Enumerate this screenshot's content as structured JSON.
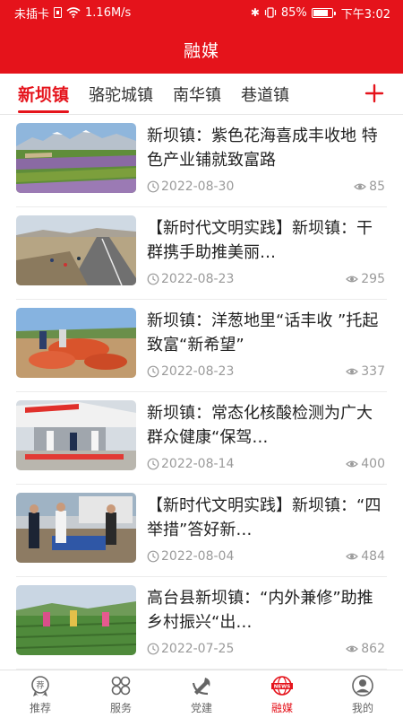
{
  "status_bar": {
    "carrier": "未插卡",
    "speed": "1.16M/s",
    "battery": "85%",
    "battery_level": 0.85,
    "time": "下午3:02"
  },
  "header": {
    "title": "融媒"
  },
  "tabs": [
    {
      "label": "新坝镇",
      "active": true
    },
    {
      "label": "骆驼城镇",
      "active": false
    },
    {
      "label": "南华镇",
      "active": false
    },
    {
      "label": "巷道镇",
      "active": false
    }
  ],
  "add_tab_icon": "plus-icon",
  "articles": [
    {
      "title": "新坝镇：紫色花海喜成丰收地 特色产业铺就致富路",
      "date": "2022-08-30",
      "views": "85"
    },
    {
      "title": "【新时代文明实践】新坝镇：干群携手助推美丽…",
      "date": "2022-08-23",
      "views": "295"
    },
    {
      "title": "新坝镇：洋葱地里“话丰收 ”托起致富“新希望”",
      "date": "2022-08-23",
      "views": "337"
    },
    {
      "title": "新坝镇：常态化核酸检测为广大群众健康“保驾…",
      "date": "2022-08-14",
      "views": "400"
    },
    {
      "title": "【新时代文明实践】新坝镇：“四举措”答好新…",
      "date": "2022-08-04",
      "views": "484"
    },
    {
      "title": "高台县新坝镇：“内外兼修”助推乡村振兴“出…",
      "date": "2022-07-25",
      "views": "862"
    }
  ],
  "bottom_nav": [
    {
      "label": "推荐",
      "icon": "recommend-icon",
      "active": false
    },
    {
      "label": "服务",
      "icon": "services-grid-icon",
      "active": false
    },
    {
      "label": "党建",
      "icon": "party-emblem-icon",
      "active": false
    },
    {
      "label": "融媒",
      "icon": "news-globe-icon",
      "active": true
    },
    {
      "label": "我的",
      "icon": "profile-icon",
      "active": false
    }
  ],
  "colors": {
    "brand_red": "#e5131b",
    "meta_gray": "#9a9a9a"
  }
}
